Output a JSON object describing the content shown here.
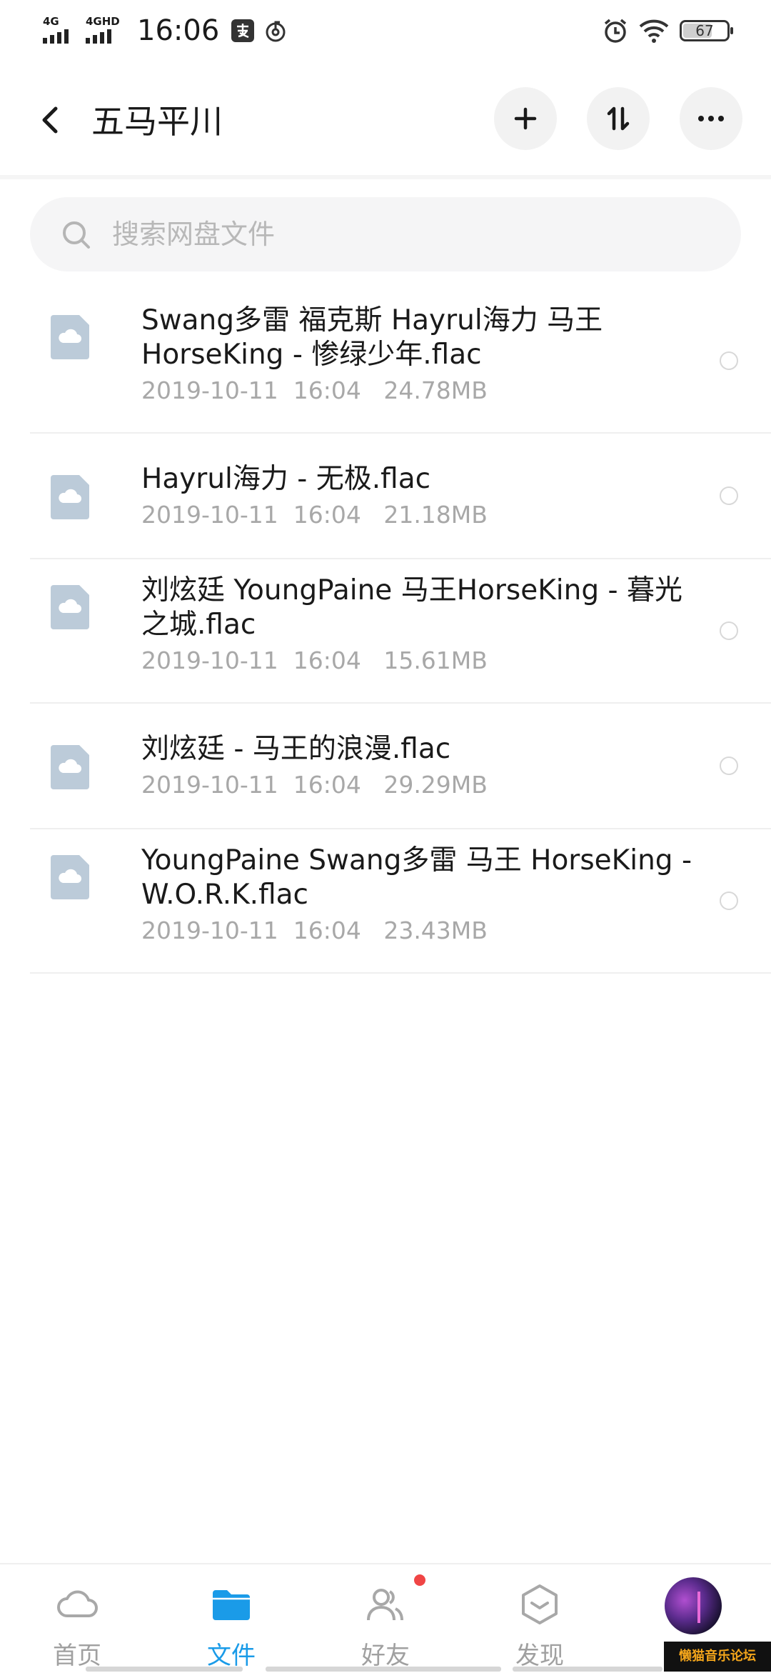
{
  "status_bar": {
    "signal1_label": "4G",
    "signal2_label": "4GHD",
    "time": "16:06",
    "battery": "67"
  },
  "header": {
    "title": "五马平川",
    "icons": [
      "back-icon",
      "plus-icon",
      "sort-icon",
      "more-icon"
    ]
  },
  "search": {
    "placeholder": "搜索网盘文件"
  },
  "files": [
    {
      "name": "Swang多雷 福克斯 Hayrul海力 马王 HorseKing - 惨绿少年.flac",
      "meta": "2019-10-11  16:04   24.78MB"
    },
    {
      "name": "Hayrul海力 - 无极.flac",
      "meta": "2019-10-11  16:04   21.18MB"
    },
    {
      "name": "刘炫廷 YoungPaine 马王HorseKing - 暮光之城.flac",
      "meta": "2019-10-11  16:04   15.61MB"
    },
    {
      "name": "刘炫廷 - 马王的浪漫.flac",
      "meta": "2019-10-11  16:04   29.29MB"
    },
    {
      "name": "YoungPaine Swang多雷 马王 HorseKing - W.O.R.K.flac",
      "meta": "2019-10-11  16:04   23.43MB"
    }
  ],
  "bottom_nav": [
    {
      "label": "首页",
      "icon": "cloud-icon"
    },
    {
      "label": "文件",
      "icon": "folder-icon",
      "active": true
    },
    {
      "label": "好友",
      "icon": "friends-icon"
    },
    {
      "label": "发现",
      "icon": "discover-icon"
    }
  ],
  "watermark": "懒猫音乐论坛",
  "colors": {
    "accent": "#1a9be8",
    "badge": "#f04545",
    "file_icon": "#bccbd9"
  }
}
